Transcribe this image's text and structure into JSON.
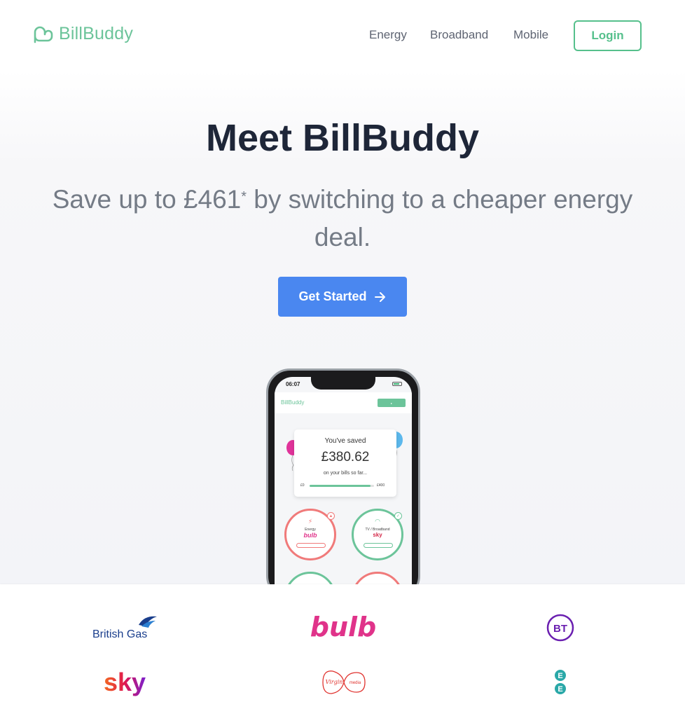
{
  "brand": {
    "name": "BillBuddy",
    "color": "#6cc49a"
  },
  "nav": {
    "links": [
      "Energy",
      "Broadband",
      "Mobile"
    ],
    "login_label": "Login"
  },
  "hero": {
    "title": "Meet BillBuddy",
    "subtitle_pre": "Save up to £461",
    "subtitle_mark": "*",
    "subtitle_post": " by switching to a cheaper energy deal.",
    "cta_label": "Get Started",
    "cta_icon": "arrow-right-icon",
    "cta_color": "#4a87f0"
  },
  "phone": {
    "time": "06:07",
    "app_name": "BillBuddy",
    "saved_title": "You've saved",
    "saved_amount": "£380.62",
    "saved_sub": "on your bills so far...",
    "range_min": "£0",
    "range_max": "£400",
    "progress_fraction": 0.95,
    "services": [
      {
        "label": "Energy",
        "brand": "bulb",
        "status": "alert",
        "color": "#f07a7a",
        "brand_color": "#e0338a"
      },
      {
        "label": "TV / Broadband",
        "brand": "sky",
        "status": "ok",
        "color": "#6cc49a",
        "brand_color": "#d42a4a"
      }
    ]
  },
  "partners": [
    "British Gas",
    "bulb",
    "BT",
    "sky",
    "Virgin media",
    "EE"
  ]
}
